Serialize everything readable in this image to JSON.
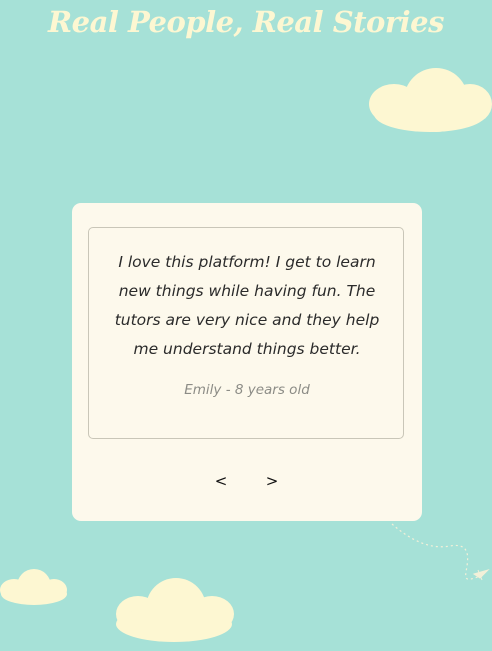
{
  "header": {
    "title": "Real People, Real Stories"
  },
  "testimonial": {
    "quote": "I love this platform! I get to learn new things while having fun. The tutors are very nice and they help me understand things better.",
    "author": "Emily - 8 years old"
  },
  "carousel": {
    "prev_label": "<",
    "next_label": ">"
  },
  "decorations": {
    "cloud_color": "#fdf7d2",
    "background_color": "#a6e1d7",
    "card_color": "#fdf9ec",
    "icons": [
      "cloud-icon",
      "paper-plane-icon"
    ]
  }
}
